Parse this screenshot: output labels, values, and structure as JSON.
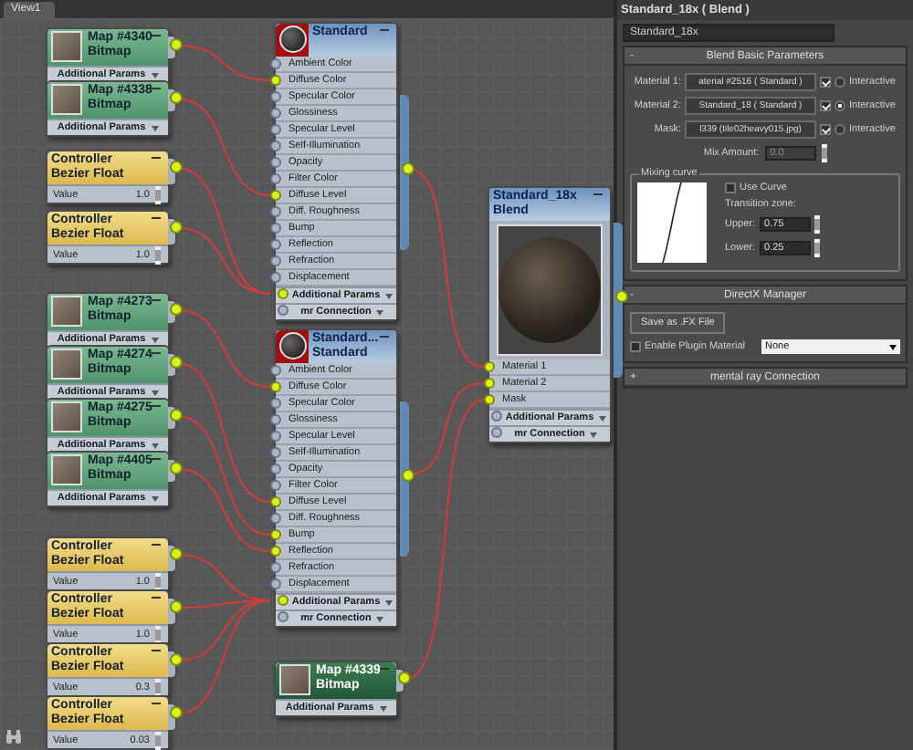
{
  "view_tab": "View1",
  "nodes": [
    {
      "kind": "bitmap",
      "selected": false,
      "title": [
        "Map #4340",
        "Bitmap"
      ],
      "footer": [
        {
          "label": "Additional Params"
        }
      ]
    },
    {
      "kind": "bitmap",
      "selected": false,
      "title": [
        "Map #4338",
        "Bitmap"
      ],
      "footer": [
        {
          "label": "Additional Params"
        }
      ]
    },
    {
      "kind": "controller",
      "selected": false,
      "title": [
        "Controller",
        "Bezier Float"
      ],
      "value_label": "Value",
      "value": "1.0"
    },
    {
      "kind": "controller",
      "selected": false,
      "title": [
        "Controller",
        "Bezier Float"
      ],
      "value_label": "Value",
      "value": "1.0"
    },
    {
      "kind": "bitmap",
      "selected": false,
      "title": [
        "Map #4273",
        "Bitmap"
      ],
      "footer": [
        {
          "label": "Additional Params"
        }
      ]
    },
    {
      "kind": "bitmap",
      "selected": false,
      "title": [
        "Map #4274",
        "Bitmap"
      ],
      "footer": [
        {
          "label": "Additional Params"
        }
      ]
    },
    {
      "kind": "bitmap",
      "selected": false,
      "title": [
        "Map #4275",
        "Bitmap"
      ],
      "footer": [
        {
          "label": "Additional Params"
        }
      ]
    },
    {
      "kind": "bitmap",
      "selected": false,
      "title": [
        "Map #4405",
        "Bitmap"
      ],
      "footer": [
        {
          "label": "Additional Params"
        }
      ]
    },
    {
      "kind": "controller",
      "selected": false,
      "title": [
        "Controller",
        "Bezier Float"
      ],
      "value_label": "Value",
      "value": "1.0"
    },
    {
      "kind": "controller",
      "selected": false,
      "title": [
        "Controller",
        "Bezier Float"
      ],
      "value_label": "Value",
      "value": "1.0"
    },
    {
      "kind": "controller",
      "selected": false,
      "title": [
        "Controller",
        "Bezier Float"
      ],
      "value_label": "Value",
      "value": "0.3"
    },
    {
      "kind": "controller",
      "selected": false,
      "title": [
        "Controller",
        "Bezier Float"
      ],
      "value_label": "Value",
      "value": "0.03"
    },
    {
      "kind": "standard",
      "selected": false,
      "title": [
        "Standard"
      ],
      "slots": [
        {
          "label": "Ambient Color",
          "connected": false
        },
        {
          "label": "Diffuse Color",
          "connected": true
        },
        {
          "label": "Specular Color",
          "connected": false
        },
        {
          "label": "Glossiness",
          "connected": false
        },
        {
          "label": "Specular Level",
          "connected": false
        },
        {
          "label": "Self-Illumination",
          "connected": false
        },
        {
          "label": "Opacity",
          "connected": false
        },
        {
          "label": "Filter Color",
          "connected": false
        },
        {
          "label": "Diffuse Level",
          "connected": true
        },
        {
          "label": "Diff. Roughness",
          "connected": false
        },
        {
          "label": "Bump",
          "connected": false
        },
        {
          "label": "Reflection",
          "connected": false
        },
        {
          "label": "Refraction",
          "connected": false
        },
        {
          "label": "Displacement",
          "connected": false
        }
      ],
      "footer": [
        {
          "label": "Additional Params",
          "connected": true
        },
        {
          "label": "mr Connection",
          "connected": false
        }
      ]
    },
    {
      "kind": "standard",
      "selected": false,
      "title": [
        "Standard...",
        "Standard"
      ],
      "slots": [
        {
          "label": "Ambient Color",
          "connected": false
        },
        {
          "label": "Diffuse Color",
          "connected": true
        },
        {
          "label": "Specular Color",
          "connected": false
        },
        {
          "label": "Glossiness",
          "connected": false
        },
        {
          "label": "Specular Level",
          "connected": false
        },
        {
          "label": "Self-Illumination",
          "connected": false
        },
        {
          "label": "Opacity",
          "connected": false
        },
        {
          "label": "Filter Color",
          "connected": false
        },
        {
          "label": "Diffuse Level",
          "connected": true
        },
        {
          "label": "Diff. Roughness",
          "connected": false
        },
        {
          "label": "Bump",
          "connected": true
        },
        {
          "label": "Reflection",
          "connected": true
        },
        {
          "label": "Refraction",
          "connected": false
        },
        {
          "label": "Displacement",
          "connected": false
        }
      ],
      "footer": [
        {
          "label": "Additional Params",
          "connected": true
        },
        {
          "label": "mr Connection",
          "connected": false
        }
      ]
    },
    {
      "kind": "blend",
      "selected": false,
      "title": [
        "Standard_18x",
        "Blend"
      ],
      "slots": [
        {
          "label": "Material 1",
          "connected": true
        },
        {
          "label": "Material 2",
          "connected": true
        },
        {
          "label": "Mask",
          "connected": true
        }
      ],
      "footer": [
        {
          "label": "Additional Params",
          "connected": false
        },
        {
          "label": "mr Connection",
          "connected": false
        }
      ]
    },
    {
      "kind": "bitmap",
      "selected": true,
      "title": [
        "Map #4339",
        "Bitmap"
      ],
      "footer": [
        {
          "label": "Additional Params"
        }
      ]
    }
  ],
  "panel": {
    "title": "Standard_18x  ( Blend )",
    "name_field": "Standard_18x",
    "blend_params": {
      "toggle": "-",
      "header": "Blend Basic Parameters",
      "materials": [
        {
          "label": "Material 1:",
          "value": "aterial #2516 ( Standard )",
          "checked": true,
          "selected": false,
          "interactive_label": "Interactive"
        },
        {
          "label": "Material 2:",
          "value": "Standard_18 ( Standard )",
          "checked": true,
          "selected": true,
          "interactive_label": "Interactive"
        },
        {
          "label": "Mask:",
          "value": "l339 (tile02heavy015.jpg)",
          "checked": true,
          "selected": false,
          "interactive_label": "Interactive"
        }
      ],
      "mix": {
        "label": "Mix Amount:",
        "value": "0.0",
        "disabled": true
      },
      "curve": {
        "group": "Mixing curve",
        "use_curve": {
          "label": "Use Curve",
          "checked": false
        },
        "transition": "Transition zone:",
        "upper": {
          "label": "Upper:",
          "value": "0.75"
        },
        "lower": {
          "label": "Lower:",
          "value": "0.25"
        }
      }
    },
    "directx": {
      "toggle": "-",
      "header": "DirectX Manager",
      "save": "Save as .FX File",
      "plugin": {
        "label": "Enable Plugin Material",
        "checked": false
      },
      "select": "None"
    },
    "mental_ray": {
      "toggle": "+",
      "header": "mental ray Connection"
    }
  }
}
